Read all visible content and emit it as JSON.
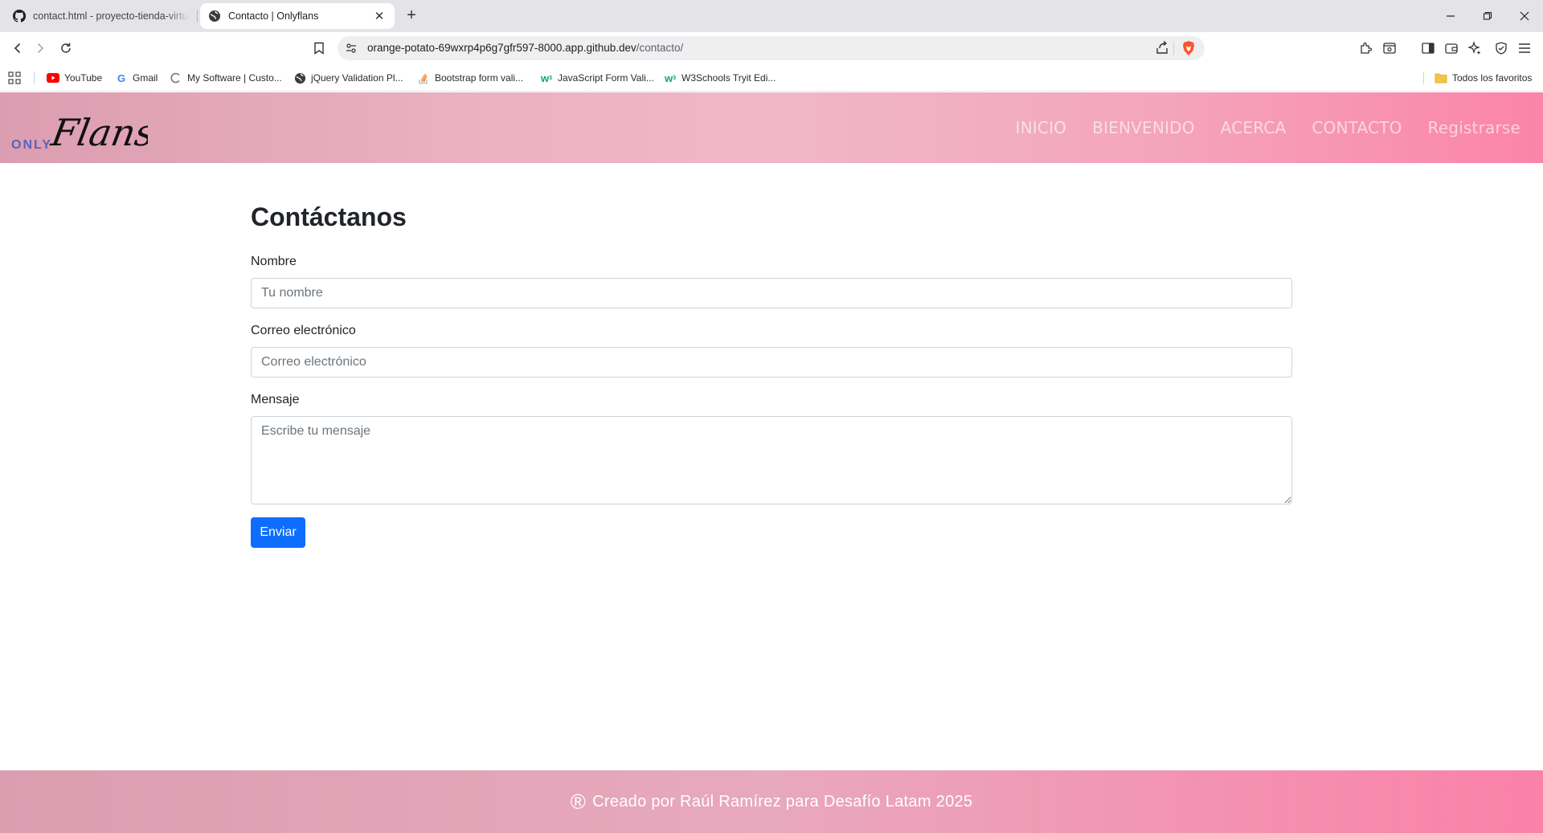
{
  "browser": {
    "tabs": [
      {
        "title": "contact.html - proyecto-tienda-virtual",
        "icon": "github-icon",
        "active": false
      },
      {
        "title": "Contacto | Onlyflans",
        "icon": "globe-icon",
        "active": true
      }
    ],
    "url": {
      "host": "orange-potato-69wxrp4p6g7gfr597-8000.app.github.dev",
      "path": "/contacto/"
    },
    "bookmarks": [
      {
        "label": "YouTube",
        "icon": "youtube-icon"
      },
      {
        "label": "Gmail",
        "icon": "google-icon"
      },
      {
        "label": "My Software | Custo...",
        "icon": "c-logo-icon"
      },
      {
        "label": "jQuery Validation Pl...",
        "icon": "globe-icon"
      },
      {
        "label": "Bootstrap form vali...",
        "icon": "stackoverflow-icon"
      },
      {
        "label": "JavaScript Form Vali...",
        "icon": "w3schools-icon"
      },
      {
        "label": "W3Schools Tryit Edi...",
        "icon": "w3schools-icon"
      }
    ],
    "all_bookmarks_label": "Todos los favoritos"
  },
  "site": {
    "logo": {
      "small": "ONLY",
      "script": "Flans",
      "small_color": "#5b63b8"
    },
    "nav": [
      "INICIO",
      "BIENVENIDO",
      "ACERCA",
      "CONTACTO",
      "Registrarse"
    ]
  },
  "form": {
    "title": "Contáctanos",
    "name_label": "Nombre",
    "name_placeholder": "Tu nombre",
    "email_label": "Correo electrónico",
    "email_placeholder": "Correo electrónico",
    "message_label": "Mensaje",
    "message_placeholder": "Escribe tu mensaje",
    "submit": "Enviar"
  },
  "footer": {
    "symbol": "®",
    "text": "Creado por Raúl Ramírez para Desafío Latam 2025"
  },
  "colors": {
    "accent": "#0d6efd",
    "brand_pink": "#fb84aa",
    "brand_soft": "#efb7c7"
  }
}
